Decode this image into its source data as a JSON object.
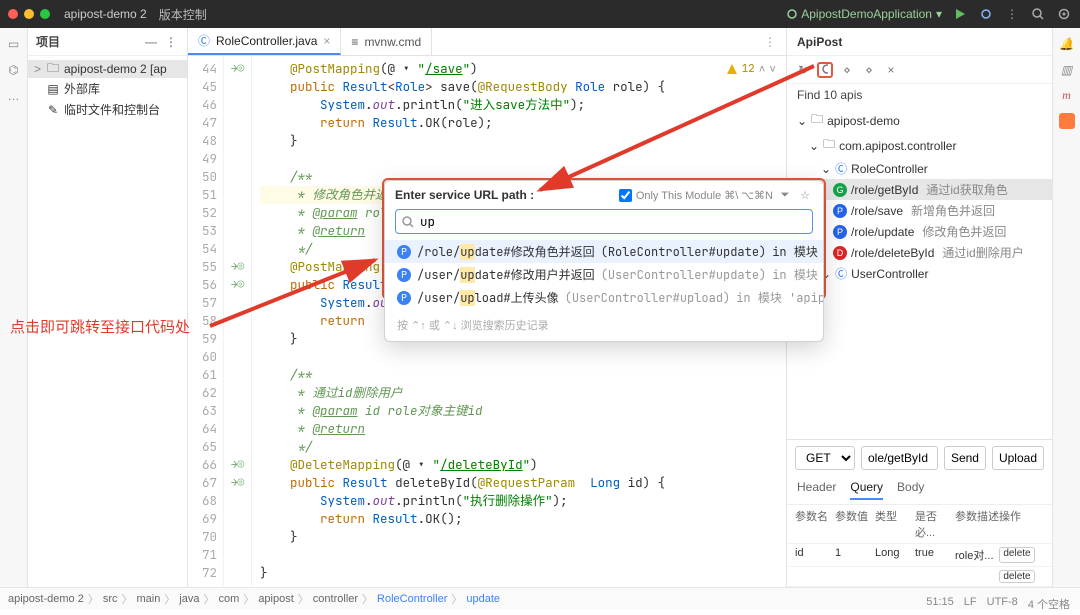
{
  "titlebar": {
    "project": "apipost-demo 2",
    "menu": "版本控制",
    "runcfg": "ApipostDemoApplication"
  },
  "project_panel": {
    "title": "项目",
    "items": [
      {
        "label": "apipost-demo 2 [ap",
        "selected": true,
        "icon": "folder"
      },
      {
        "label": "外部库",
        "icon": "lib"
      },
      {
        "label": "临时文件和控制台",
        "icon": "scratch"
      }
    ]
  },
  "tabs": [
    {
      "label": "RoleController.java",
      "active": true,
      "icon": "class"
    },
    {
      "label": "mvnw.cmd",
      "active": false,
      "icon": "file"
    }
  ],
  "warn": {
    "count": "12"
  },
  "code": {
    "start": 44,
    "lines": [
      {
        "n": 44,
        "mk": "→◎",
        "txt": "    @PostMapping(@ ▾ \"/save\")",
        "cls": ""
      },
      {
        "n": 45,
        "mk": "",
        "txt": "    public Result<Role> save(@RequestBody Role role) {",
        "cls": ""
      },
      {
        "n": 46,
        "mk": "",
        "txt": "        System.out.println(\"进入save方法中\");",
        "cls": ""
      },
      {
        "n": 47,
        "mk": "",
        "txt": "        return Result.OK(role);",
        "cls": ""
      },
      {
        "n": 48,
        "mk": "",
        "txt": "    }",
        "cls": ""
      },
      {
        "n": 49,
        "mk": "",
        "txt": "",
        "cls": ""
      },
      {
        "n": 50,
        "mk": "",
        "txt": "    /**",
        "cls": "doc"
      },
      {
        "n": 51,
        "mk": "",
        "txt": "     * 修改角色并返回",
        "cls": "doc hl"
      },
      {
        "n": 52,
        "mk": "",
        "txt": "     * @param role",
        "cls": "doc"
      },
      {
        "n": 53,
        "mk": "",
        "txt": "     * @return",
        "cls": "doc"
      },
      {
        "n": 54,
        "mk": "",
        "txt": "     */",
        "cls": "doc"
      },
      {
        "n": 55,
        "mk": "→◎",
        "txt": "    @PostMapping(@ ▾ \"/update\")",
        "cls": ""
      },
      {
        "n": 56,
        "mk": "→◎",
        "txt": "    public Result<Role> ",
        "cls": ""
      },
      {
        "n": 57,
        "mk": "",
        "txt": "        System.out.p      \"进",
        "cls": ""
      },
      {
        "n": 58,
        "mk": "",
        "txt": "        return    lt.OK(role)",
        "cls": ""
      },
      {
        "n": 59,
        "mk": "",
        "txt": "    }",
        "cls": ""
      },
      {
        "n": 60,
        "mk": "",
        "txt": "",
        "cls": ""
      },
      {
        "n": 61,
        "mk": "",
        "txt": "    /**",
        "cls": "doc"
      },
      {
        "n": 62,
        "mk": "",
        "txt": "     * 通过id删除用户",
        "cls": "doc"
      },
      {
        "n": 63,
        "mk": "",
        "txt": "     * @param id role对象主键id",
        "cls": "doc"
      },
      {
        "n": 64,
        "mk": "",
        "txt": "     * @return",
        "cls": "doc"
      },
      {
        "n": 65,
        "mk": "",
        "txt": "     */",
        "cls": "doc"
      },
      {
        "n": 66,
        "mk": "→◎",
        "txt": "    @DeleteMapping(@ ▾ \"/deleteById\")",
        "cls": ""
      },
      {
        "n": 67,
        "mk": "→◎",
        "txt": "    public Result<?> deleteById(@RequestParam  Long id) {",
        "cls": ""
      },
      {
        "n": 68,
        "mk": "",
        "txt": "        System.out.println(\"执行删除操作\");",
        "cls": ""
      },
      {
        "n": 69,
        "mk": "",
        "txt": "        return Result.OK();",
        "cls": ""
      },
      {
        "n": 70,
        "mk": "",
        "txt": "    }",
        "cls": ""
      },
      {
        "n": 71,
        "mk": "",
        "txt": "",
        "cls": ""
      },
      {
        "n": 72,
        "mk": "",
        "txt": "}",
        "cls": ""
      }
    ]
  },
  "popup": {
    "title": "Enter service URL path :",
    "module_label": "Only This Module ⌘\\ ⌥⌘N",
    "input": "up",
    "items": [
      {
        "path": "/role/update",
        "desc": "#修改角色并返回",
        "where": "(RoleController#update)",
        "in": "in 模块 'apipost-demo'",
        "sel": true
      },
      {
        "path": "/user/update",
        "desc": "#修改用户并返回",
        "where": "(UserController#update)",
        "in": "in 模块 'apipost-demo'",
        "sel": false
      },
      {
        "path": "/user/upload",
        "desc": "#上传头像",
        "where": "(UserController#upload)",
        "in": "in 模块 'apipost-demo'",
        "sel": false
      }
    ],
    "hint": "按 ⌃↑ 或 ⌃↓ 浏览搜索历史记录"
  },
  "rpanel": {
    "title": "ApiPost",
    "find": "Find 10 apis",
    "tree": [
      {
        "ind": 1,
        "type": "folder",
        "label": "apipost-demo"
      },
      {
        "ind": 2,
        "type": "folder",
        "label": "com.apipost.controller"
      },
      {
        "ind": 3,
        "type": "class",
        "label": "RoleController"
      },
      {
        "ind": 4,
        "type": "api",
        "meth": "G",
        "path": "/role/getById",
        "note": "通过id获取角色",
        "sel": true
      },
      {
        "ind": 4,
        "type": "api",
        "meth": "P",
        "path": "/role/save",
        "note": "新增角色并返回"
      },
      {
        "ind": 4,
        "type": "api",
        "meth": "P",
        "path": "/role/update",
        "note": "修改角色并返回"
      },
      {
        "ind": 4,
        "type": "api",
        "meth": "D",
        "path": "/role/deleteById",
        "note": "通过id删除用户"
      },
      {
        "ind": 3,
        "type": "class",
        "label": "UserController"
      }
    ],
    "request": {
      "method": "GET",
      "url": "ole/getById",
      "send": "Send",
      "upload": "Upload",
      "tabs": [
        "Header",
        "Query",
        "Body"
      ],
      "selected_tab": 1,
      "columns": [
        "参数名",
        "参数值",
        "类型",
        "是否必...",
        "参数描述",
        "操作"
      ],
      "rows": [
        {
          "name": "id",
          "value": "1",
          "type": "Long",
          "req": "true",
          "desc": "role对..."
        }
      ],
      "delete_label": "delete"
    }
  },
  "crumbs": [
    "apipost-demo 2",
    "src",
    "main",
    "java",
    "com",
    "apipost",
    "controller",
    "RoleController",
    "update"
  ],
  "status": {
    "pos": "51:15",
    "le": "LF",
    "enc": "UTF-8",
    "indent": "4 个空格"
  },
  "annotation": "点击即可跳转至接口代码处"
}
